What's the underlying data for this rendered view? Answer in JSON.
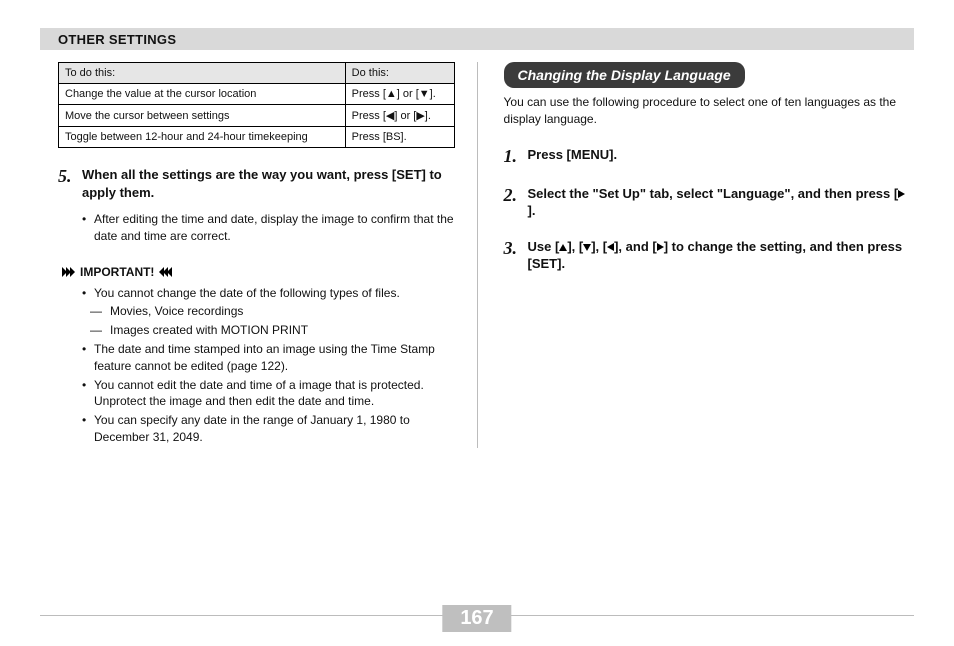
{
  "header": "OTHER SETTINGS",
  "table": {
    "head": [
      "To do this:",
      "Do this:"
    ],
    "rows": [
      [
        "Change the value at the cursor location",
        "Press [▲] or [▼]."
      ],
      [
        "Move the cursor between settings",
        "Press [◀] or [▶]."
      ],
      [
        "Toggle between 12-hour and 24-hour timekeeping",
        "Press [BS]."
      ]
    ]
  },
  "left": {
    "step5_num": "5.",
    "step5_text": "When all the settings are the way you want, press [SET] to apply them.",
    "step5_sub": "After editing the time and date, display the image to confirm that the date and time are correct.",
    "important_label": "IMPORTANT!",
    "imp1a": "You cannot change the date of the following types of files.",
    "imp1b": "Movies, Voice recordings",
    "imp1c": "Images created with MOTION PRINT",
    "imp2": "The date and time stamped into an image using the Time Stamp feature cannot be edited (page 122).",
    "imp3": "You cannot edit the date and time of a image that is protected. Unprotect the image and then edit the date and time.",
    "imp4": "You can specify any date in the range of January 1, 1980 to December 31, 2049."
  },
  "right": {
    "pill": "Changing the Display Language",
    "intro": "You can use the following procedure to select one of ten languages as the display language.",
    "s1n": "1.",
    "s1": "Press [MENU].",
    "s2n": "2.",
    "s2a": "Select the \"Set Up\" tab, select \"Language\", and then press [",
    "s2b": "].",
    "s3n": "3.",
    "s3a": "Use [",
    "s3b": "], [",
    "s3c": "], [",
    "s3d": "], and [",
    "s3e": "] to change the setting, and then press [SET]."
  },
  "page_number": "167"
}
